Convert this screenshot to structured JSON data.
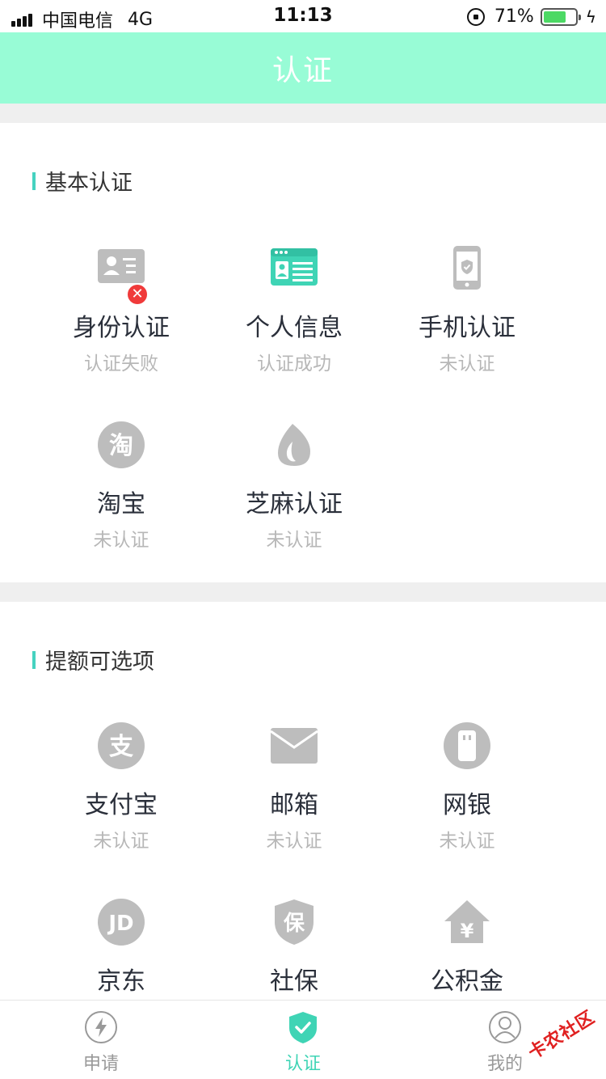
{
  "status_bar": {
    "carrier": "中国电信",
    "network": "4G",
    "time": "11:13",
    "battery": "71%",
    "battery_level": 0.71
  },
  "nav": {
    "title": "认证"
  },
  "basic": {
    "title": "基本认证",
    "items": [
      {
        "label": "身份认证",
        "status": "认证失败"
      },
      {
        "label": "个人信息",
        "status": "认证成功"
      },
      {
        "label": "手机认证",
        "status": "未认证"
      },
      {
        "label": "淘宝",
        "status": "未认证"
      },
      {
        "label": "芝麻认证",
        "status": "未认证"
      }
    ]
  },
  "optional": {
    "title": "提额可选项",
    "items": [
      {
        "label": "支付宝",
        "status": "未认证"
      },
      {
        "label": "邮箱",
        "status": "未认证"
      },
      {
        "label": "网银",
        "status": "未认证"
      },
      {
        "label": "京东",
        "status": ""
      },
      {
        "label": "社保",
        "status": ""
      },
      {
        "label": "公积金",
        "status": ""
      }
    ]
  },
  "icons": {
    "taobao_glyph": "淘",
    "alipay_glyph": "支",
    "jd_glyph": "JD",
    "shebao_glyph": "保",
    "gjj_glyph": "¥"
  },
  "tabbar": {
    "tabs": [
      {
        "label": "申请",
        "active": false
      },
      {
        "label": "认证",
        "active": true
      },
      {
        "label": "我的",
        "active": false
      }
    ]
  },
  "watermark": "卡农社区",
  "colors": {
    "accent": "#3fd4b5",
    "nav_bg": "#98fcd6",
    "error": "#f03a3a",
    "icon_gray": "#bdbdbd"
  }
}
